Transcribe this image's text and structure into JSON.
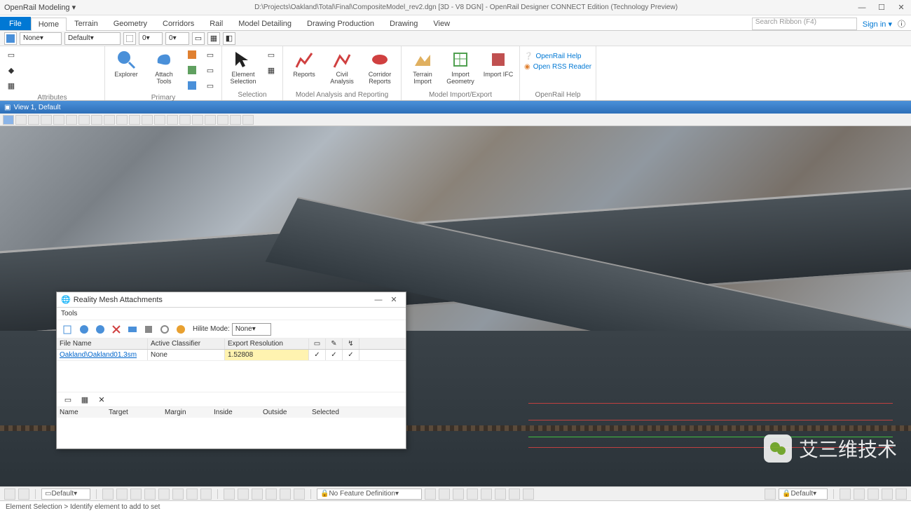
{
  "window": {
    "menu": "OpenRail Modeling",
    "title": "D:\\Projects\\Oakland\\Total\\Final\\CompositeModel_rev2.dgn [3D - V8 DGN] - OpenRail Designer CONNECT Edition (Technology Preview)",
    "search_placeholder": "Search Ribbon (F4)",
    "signin": "Sign in"
  },
  "tabs": {
    "file": "File",
    "list": [
      "Home",
      "Terrain",
      "Geometry",
      "Corridors",
      "Rail",
      "Model Detailing",
      "Drawing Production",
      "Drawing",
      "View"
    ],
    "active": "Home"
  },
  "qat": {
    "level_label": "None",
    "level_value": "Default",
    "num_a": "0",
    "num_b": "0"
  },
  "ribbon": {
    "attributes": {
      "label": "Attributes"
    },
    "primary": {
      "label": "Primary",
      "explorer": "Explorer",
      "attach": "Attach Tools"
    },
    "selection": {
      "label": "Selection",
      "elsel": "Element Selection"
    },
    "analysis": {
      "label": "Model Analysis and Reporting",
      "reports": "Reports",
      "civil": "Civil Analysis",
      "corridor": "Corridor Reports"
    },
    "import": {
      "label": "Model Import/Export",
      "terrain": "Terrain Import",
      "geom": "Import Geometry",
      "ifc": "Import IFC"
    },
    "help": {
      "label": "OpenRail Help",
      "link1": "OpenRail Help",
      "link2": "Open RSS Reader"
    }
  },
  "view": {
    "title": "View 1, Default"
  },
  "dialog": {
    "title": "Reality Mesh Attachments",
    "menu_tools": "Tools",
    "hilite_label": "Hilite Mode:",
    "hilite_value": "None",
    "cols": {
      "fname": "File Name",
      "classifier": "Active Classifier",
      "export": "Export Resolution"
    },
    "row": {
      "fname": "Oakland\\Oakland01.3sm",
      "classifier": "None",
      "export": "1.52808"
    },
    "cols2": {
      "name": "Name",
      "target": "Target",
      "margin": "Margin",
      "inside": "Inside",
      "outside": "Outside",
      "selected": "Selected"
    }
  },
  "bottom": {
    "level_combo": "Default",
    "feat_label": "No Feature Definition",
    "right_combo": "Default"
  },
  "status": {
    "prompt": "Element Selection > Identify element to add to set"
  },
  "watermark": "艾三维技术"
}
